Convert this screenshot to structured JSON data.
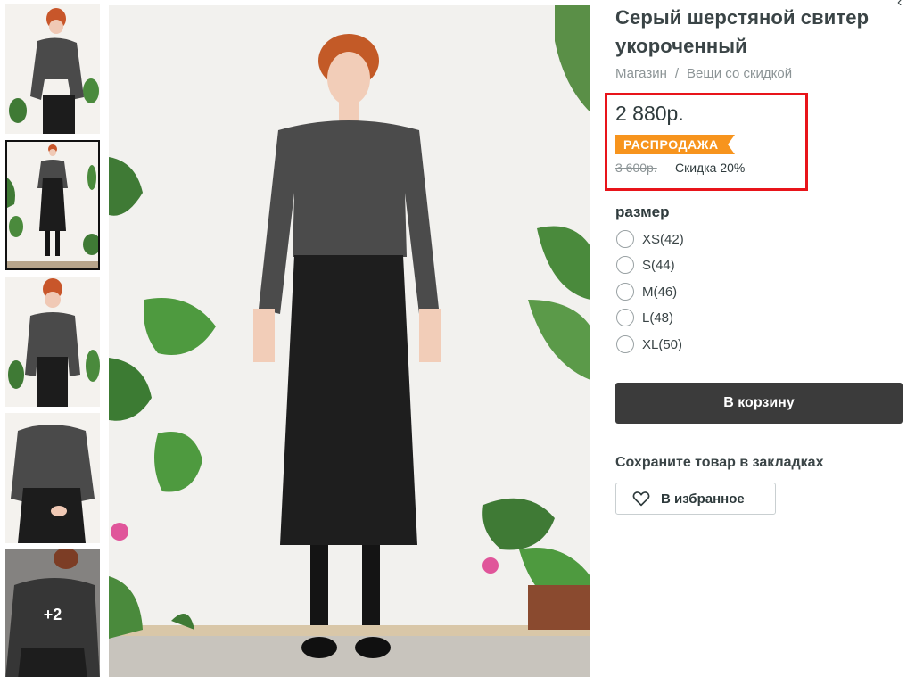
{
  "product": {
    "title": "Серый шерстяной свитер укороченный"
  },
  "breadcrumb": {
    "items": [
      "Магазин",
      "Вещи со скидкой"
    ],
    "separator": "/"
  },
  "pricing": {
    "price": "2 880р.",
    "sale_badge": "РАСПРОДАЖА",
    "old_price": "3 600р.",
    "discount": "Скидка 20%",
    "highlight_color": "#e8141a",
    "badge_color": "#f7941d"
  },
  "size": {
    "label": "размер",
    "options": [
      "XS(42)",
      "S(44)",
      "M(46)",
      "L(48)",
      "XL(50)"
    ],
    "selected": null
  },
  "cart": {
    "button_label": "В корзину",
    "button_color": "#3b3b3b"
  },
  "bookmarks": {
    "title": "Сохраните товар в закладках",
    "favorite_label": "В избранное",
    "icon": "heart-outline-icon"
  },
  "gallery": {
    "thumbnail_count": 5,
    "active_thumbnail": 2,
    "more_label": "+2"
  },
  "corner_glyph": "‹"
}
